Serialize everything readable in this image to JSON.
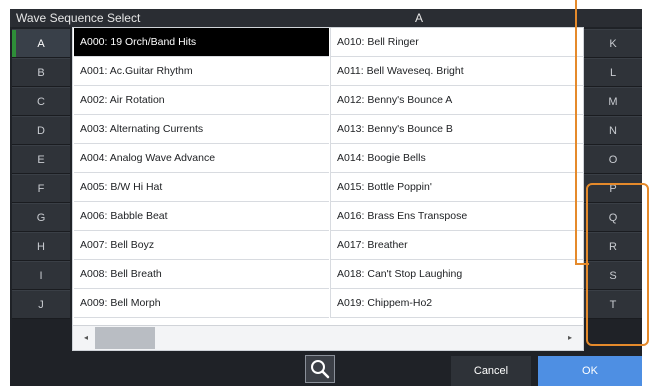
{
  "titlebar": {
    "title": "Wave Sequence Select",
    "current_bank": "A"
  },
  "banks_left": [
    "A",
    "B",
    "C",
    "D",
    "E",
    "F",
    "G",
    "H",
    "I",
    "J"
  ],
  "banks_right": [
    "K",
    "L",
    "M",
    "N",
    "O",
    "P",
    "Q",
    "R",
    "S",
    "T"
  ],
  "active_bank": "A",
  "list_left": [
    "A000: 19 Orch/Band Hits",
    "A001: Ac.Guitar Rhythm",
    "A002: Air Rotation",
    "A003: Alternating Currents",
    "A004: Analog Wave Advance",
    "A005: B/W Hi Hat",
    "A006: Babble Beat",
    "A007: Bell Boyz",
    "A008: Bell Breath",
    "A009: Bell Morph"
  ],
  "list_right": [
    "A010: Bell Ringer",
    "A011: Bell Waveseq. Bright",
    "A012: Benny's Bounce A",
    "A013: Benny's Bounce B",
    "A014: Boogie Bells",
    "A015: Bottle Poppin'",
    "A016: Brass Ens Transpose",
    "A017: Breather",
    "A018: Can't Stop Laughing",
    "A019: Chippem-Ho2"
  ],
  "selected_item": "A000: 19 Orch/Band Hits",
  "scrollbar": {
    "left_arrow": "◂",
    "right_arrow": "▸"
  },
  "bottom": {
    "search_icon": "search-icon",
    "cancel_label": "Cancel",
    "ok_label": "OK"
  },
  "colors": {
    "accent_green": "#2e8e38",
    "ok_blue": "#4e8fe3",
    "highlight_orange": "#e58a2b"
  }
}
